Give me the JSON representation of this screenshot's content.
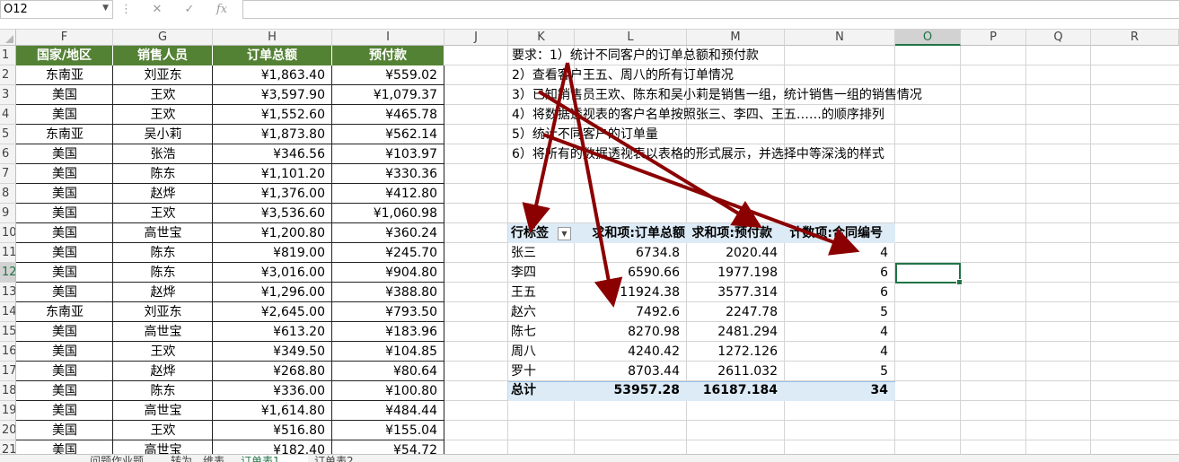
{
  "name_box": "O12",
  "formula_icons": [
    "cancel-icon",
    "enter-icon",
    "function-icon"
  ],
  "formula_fx": "fx",
  "columns": [
    "F",
    "G",
    "H",
    "I",
    "J",
    "K",
    "L",
    "M",
    "N",
    "O",
    "P",
    "Q",
    "R"
  ],
  "rows": [
    "1",
    "2",
    "3",
    "4",
    "5",
    "6",
    "7",
    "8",
    "9",
    "10",
    "11",
    "12",
    "13",
    "14",
    "15",
    "16",
    "17",
    "18",
    "19",
    "20",
    "21"
  ],
  "table": {
    "headers": [
      "国家/地区",
      "销售人员",
      "订单总额",
      "预付款"
    ],
    "rows": [
      [
        "东南亚",
        "刘亚东",
        "¥1,863.40",
        "¥559.02"
      ],
      [
        "美国",
        "王欢",
        "¥3,597.90",
        "¥1,079.37"
      ],
      [
        "美国",
        "王欢",
        "¥1,552.60",
        "¥465.78"
      ],
      [
        "东南亚",
        "吴小莉",
        "¥1,873.80",
        "¥562.14"
      ],
      [
        "美国",
        "张浩",
        "¥346.56",
        "¥103.97"
      ],
      [
        "美国",
        "陈东",
        "¥1,101.20",
        "¥330.36"
      ],
      [
        "美国",
        "赵烨",
        "¥1,376.00",
        "¥412.80"
      ],
      [
        "美国",
        "王欢",
        "¥3,536.60",
        "¥1,060.98"
      ],
      [
        "美国",
        "高世宝",
        "¥1,200.80",
        "¥360.24"
      ],
      [
        "美国",
        "陈东",
        "¥819.00",
        "¥245.70"
      ],
      [
        "美国",
        "陈东",
        "¥3,016.00",
        "¥904.80"
      ],
      [
        "美国",
        "赵烨",
        "¥1,296.00",
        "¥388.80"
      ],
      [
        "东南亚",
        "刘亚东",
        "¥2,645.00",
        "¥793.50"
      ],
      [
        "美国",
        "高世宝",
        "¥613.20",
        "¥183.96"
      ],
      [
        "美国",
        "王欢",
        "¥349.50",
        "¥104.85"
      ],
      [
        "美国",
        "赵烨",
        "¥268.80",
        "¥80.64"
      ],
      [
        "美国",
        "陈东",
        "¥336.00",
        "¥100.80"
      ],
      [
        "美国",
        "高世宝",
        "¥1,614.80",
        "¥484.44"
      ],
      [
        "美国",
        "王欢",
        "¥516.80",
        "¥155.04"
      ],
      [
        "美国",
        "高世宝",
        "¥182.40",
        "¥54.72"
      ]
    ]
  },
  "requirements": [
    "要求：1）统计不同客户的订单总额和预付款",
    "2）查看客户王五、周八的所有订单情况",
    "3）已知销售员王欢、陈东和吴小莉是销售一组，统计销售一组的销售情况",
    "4）将数据透视表的客户名单按照张三、李四、王五……的顺序排列",
    "5）统计不同客户的订单量",
    "6）将所有的数据透视表以表格的形式展示，并选择中等深浅的样式"
  ],
  "pivot": {
    "headers": [
      "行标签",
      "求和项:订单总额",
      "求和项:预付款",
      "计数项:合同编号"
    ],
    "rows": [
      [
        "张三",
        "6734.8",
        "2020.44",
        "4"
      ],
      [
        "李四",
        "6590.66",
        "1977.198",
        "6"
      ],
      [
        "王五",
        "11924.38",
        "3577.314",
        "6"
      ],
      [
        "赵六",
        "7492.6",
        "2247.78",
        "5"
      ],
      [
        "陈七",
        "8270.98",
        "2481.294",
        "4"
      ],
      [
        "周八",
        "4240.42",
        "1272.126",
        "4"
      ],
      [
        "罗十",
        "8703.44",
        "2611.032",
        "5"
      ]
    ],
    "total": [
      "总计",
      "53957.28",
      "16187.184",
      "34"
    ]
  },
  "sheet_tabs": [
    "问题作业题",
    "转为…维表",
    "订单表1",
    "订单表2"
  ],
  "active_tab": "订单表1",
  "colors": {
    "header_green": "#548235",
    "pivot_blue": "#ddebf7",
    "arrow_red": "#8b0000",
    "select_green": "#217346"
  }
}
